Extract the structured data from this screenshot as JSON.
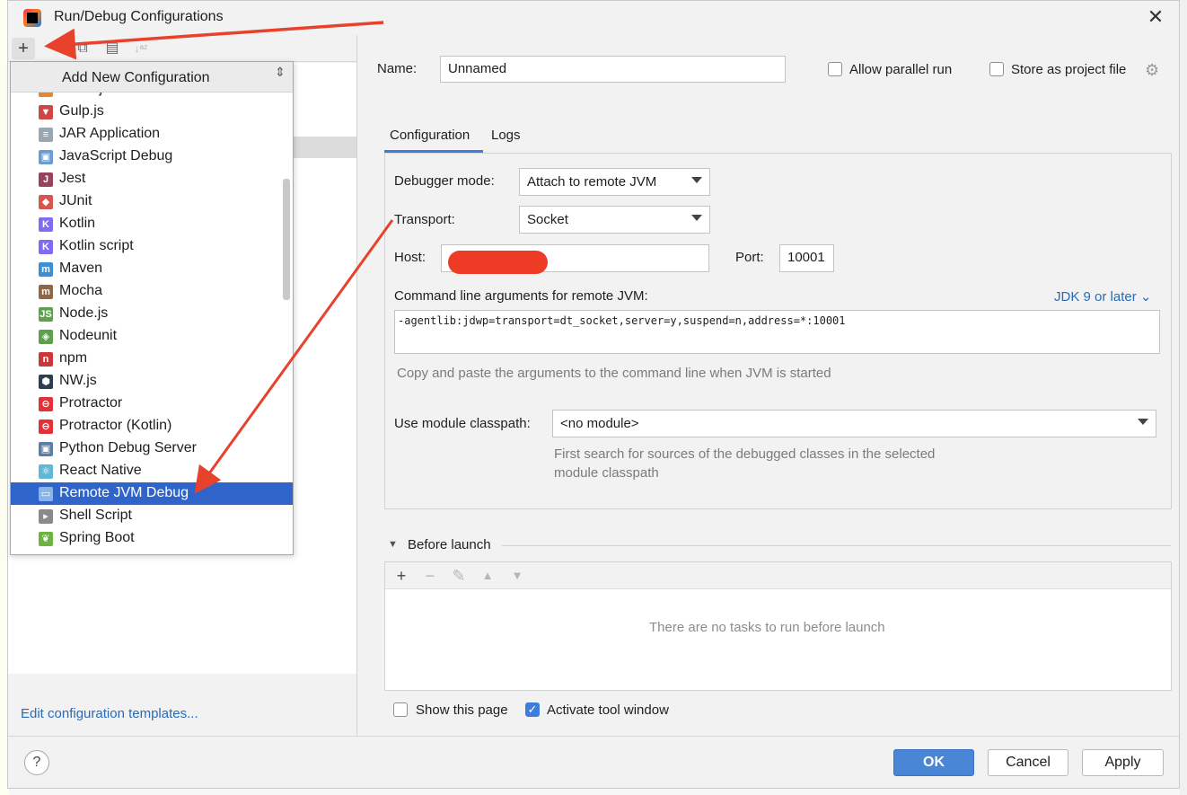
{
  "window": {
    "title": "Run/Debug Configurations",
    "close_glyph": "✕",
    "app_icon": "intellij-idea-icon"
  },
  "left_toolbar": {
    "add_glyph": "+",
    "copy_glyph": "⧉",
    "folder_glyph": "▤",
    "sort_glyph": "↓ᵃᶻ"
  },
  "popup": {
    "title": "Add New Configuration",
    "collapse_glyph": "⇕",
    "items": [
      {
        "label": "Grunt.js",
        "icon": "grunt-icon",
        "color": "#e48632",
        "glyph": "G"
      },
      {
        "label": "Gulp.js",
        "icon": "gulp-icon",
        "color": "#cf4647",
        "glyph": "▼"
      },
      {
        "label": "JAR Application",
        "icon": "jar-icon",
        "color": "#9aa7b0",
        "glyph": "≡"
      },
      {
        "label": "JavaScript Debug",
        "icon": "javascript-debug-icon",
        "color": "#6a9bd1",
        "glyph": "▣"
      },
      {
        "label": "Jest",
        "icon": "jest-icon",
        "color": "#99425b",
        "glyph": "J"
      },
      {
        "label": "JUnit",
        "icon": "junit-icon",
        "color": "#d9534f",
        "glyph": "◆"
      },
      {
        "label": "Kotlin",
        "icon": "kotlin-icon",
        "color": "#7f6cf3",
        "glyph": "K"
      },
      {
        "label": "Kotlin script",
        "icon": "kotlin-script-icon",
        "color": "#7f6cf3",
        "glyph": "K"
      },
      {
        "label": "Maven",
        "icon": "maven-icon",
        "color": "#3d8fd1",
        "glyph": "m"
      },
      {
        "label": "Mocha",
        "icon": "mocha-icon",
        "color": "#8d6748",
        "glyph": "m"
      },
      {
        "label": "Node.js",
        "icon": "nodejs-icon",
        "color": "#5fa04e",
        "glyph": "JS"
      },
      {
        "label": "Nodeunit",
        "icon": "nodeunit-icon",
        "color": "#5fa04e",
        "glyph": "◈"
      },
      {
        "label": "npm",
        "icon": "npm-icon",
        "color": "#cb3837",
        "glyph": "n"
      },
      {
        "label": "NW.js",
        "icon": "nwjs-icon",
        "color": "#2e3e50",
        "glyph": "⬢"
      },
      {
        "label": "Protractor",
        "icon": "protractor-icon",
        "color": "#e23237",
        "glyph": "⊖"
      },
      {
        "label": "Protractor (Kotlin)",
        "icon": "protractor-kotlin-icon",
        "color": "#e23237",
        "glyph": "⊖"
      },
      {
        "label": "Python Debug Server",
        "icon": "python-debug-server-icon",
        "color": "#5b7fa6",
        "glyph": "▣"
      },
      {
        "label": "React Native",
        "icon": "react-native-icon",
        "color": "#61b8d6",
        "glyph": "⚛"
      },
      {
        "label": "Remote JVM Debug",
        "icon": "remote-jvm-debug-icon",
        "color": "#8ab4e8",
        "glyph": "▭",
        "selected": true
      },
      {
        "label": "Shell Script",
        "icon": "shell-script-icon",
        "color": "#8a8a8a",
        "glyph": "▸"
      },
      {
        "label": "Spring Boot",
        "icon": "spring-boot-icon",
        "color": "#6db33f",
        "glyph": "❦"
      }
    ]
  },
  "edit_templates_link": "Edit configuration templates...",
  "form": {
    "name_label": "Name:",
    "name_value": "Unnamed",
    "allow_parallel_label": "Allow parallel run",
    "store_project_label": "Store as project file",
    "tabs": [
      "Configuration",
      "Logs"
    ],
    "debugger_mode_label": "Debugger mode:",
    "debugger_mode_value": "Attach to remote JVM",
    "transport_label": "Transport:",
    "transport_value": "Socket",
    "host_label": "Host:",
    "host_value": "",
    "port_label": "Port:",
    "port_value": "10001",
    "cmd_args_label": "Command line arguments for remote JVM:",
    "jdk_link": "JDK 9 or later ⌄",
    "cmd_args_value": "-agentlib:jdwp=transport=dt_socket,server=y,suspend=n,address=*:10001",
    "cmd_args_hint": "Copy and paste the arguments to the command line when JVM is started",
    "module_label": "Use module classpath:",
    "module_value": "<no module>",
    "module_hint_1": "First search for sources of the debugged classes in the selected",
    "module_hint_2": "module classpath"
  },
  "before_launch": {
    "title": "Before launch",
    "toggle_glyph": "▼",
    "empty_text": "There are no tasks to run before launch",
    "add_glyph": "+",
    "remove_glyph": "−",
    "edit_glyph": "✎",
    "up_glyph": "▲",
    "down_glyph": "▼"
  },
  "options": {
    "show_page_label": "Show this page",
    "activate_tool_label": "Activate tool window",
    "activate_checked_glyph": "✓"
  },
  "buttons": {
    "help": "?",
    "ok": "OK",
    "cancel": "Cancel",
    "apply": "Apply"
  },
  "colors": {
    "accent": "#3c7ddd",
    "selection": "#2f65ca",
    "annotation_arrow": "#e8412c"
  }
}
